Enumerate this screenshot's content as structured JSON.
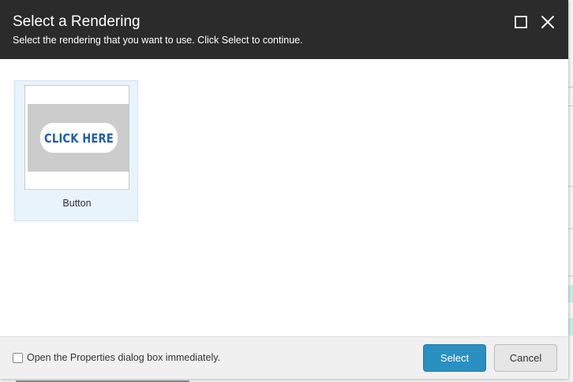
{
  "dialog": {
    "title": "Select a Rendering",
    "subtitle": "Select the rendering that you want to use. Click Select to continue.",
    "header_icons": [
      "maximize-icon",
      "close-icon"
    ]
  },
  "renderings": [
    {
      "label": "Button",
      "thumbnail_text": "CLICK HERE",
      "selected": true
    }
  ],
  "footer": {
    "checkbox_label": "Open the Properties dialog box immediately.",
    "checkbox_checked": false,
    "select_label": "Select",
    "cancel_label": "Cancel"
  },
  "colors": {
    "header_bg": "#2b2b2b",
    "tile_selected_bg": "#e8f3fc",
    "primary_button": "#2a8fc1",
    "thumbnail_text": "#1f5fae"
  }
}
